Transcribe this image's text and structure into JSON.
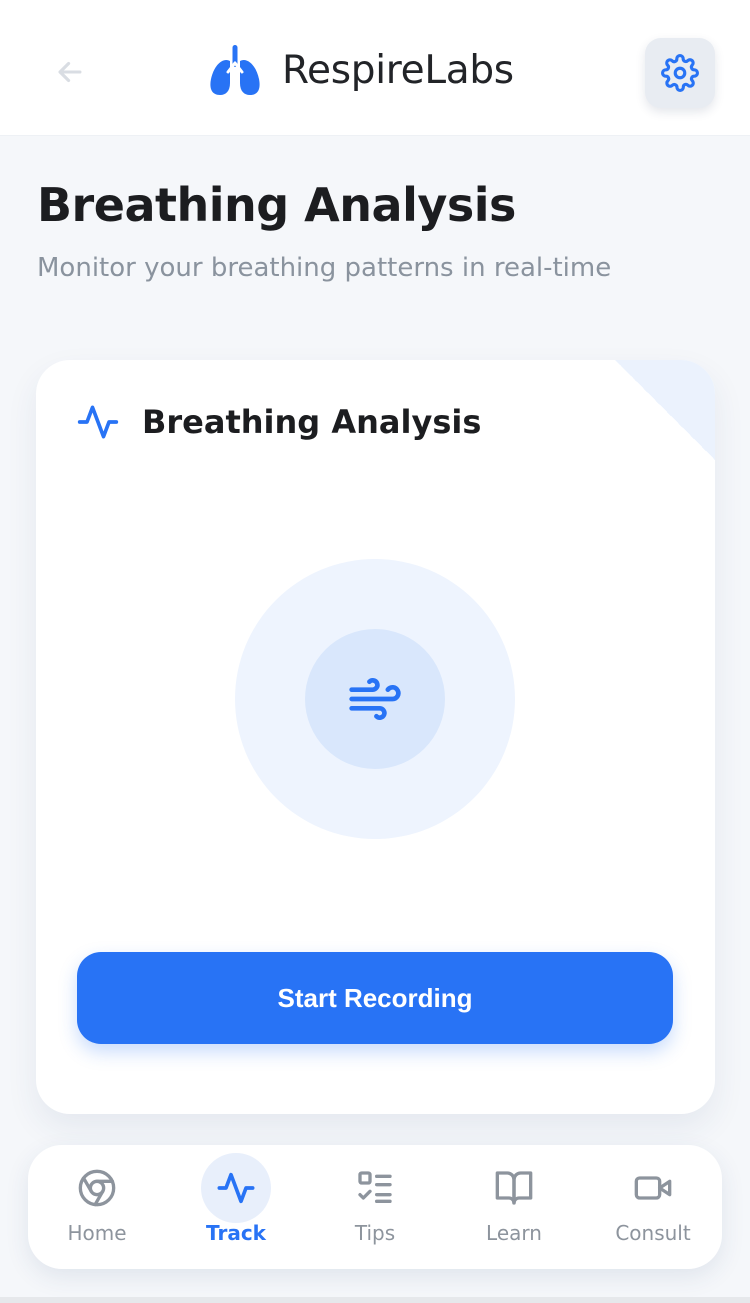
{
  "header": {
    "brand_name": "RespireLabs",
    "back_icon": "arrow-left-icon",
    "logo_icon": "lungs-icon",
    "settings_icon": "gear-icon"
  },
  "page": {
    "title": "Breathing Analysis",
    "subtitle": "Monitor your breathing patterns in real-time"
  },
  "card": {
    "title": "Breathing Analysis",
    "header_icon": "activity-pulse-icon",
    "center_icon": "wind-icon",
    "button_label": "Start Recording"
  },
  "nav": {
    "items": [
      {
        "label": "Home",
        "icon": "chrome-circle-icon",
        "active": false
      },
      {
        "label": "Track",
        "icon": "activity-pulse-icon",
        "active": true
      },
      {
        "label": "Tips",
        "icon": "checklist-icon",
        "active": false
      },
      {
        "label": "Learn",
        "icon": "open-book-icon",
        "active": false
      },
      {
        "label": "Consult",
        "icon": "video-camera-icon",
        "active": false
      }
    ]
  },
  "colors": {
    "primary": "#2873f5",
    "text_dark": "#1c1d20",
    "text_muted": "#8a939e",
    "background": "#f5f7fa"
  }
}
